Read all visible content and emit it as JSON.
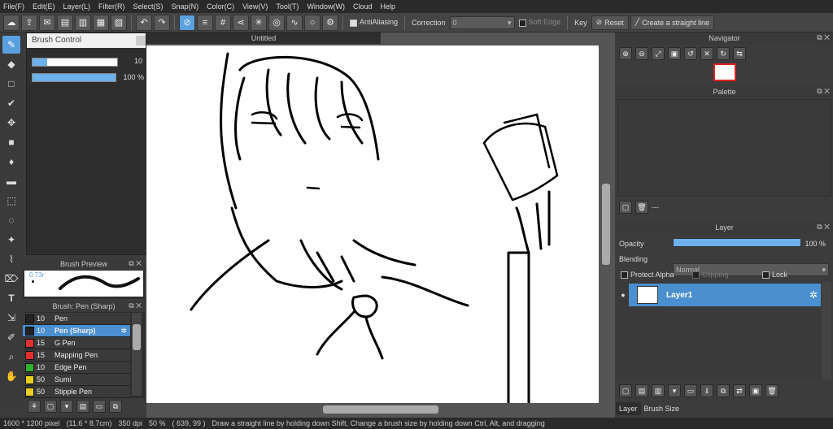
{
  "menu": [
    "File(F)",
    "Edit(E)",
    "Layer(L)",
    "Filter(R)",
    "Select(S)",
    "Snap(N)",
    "Color(C)",
    "View(V)",
    "Tool(T)",
    "Window(W)",
    "Cloud",
    "Help"
  ],
  "toolbar": {
    "antialiasing": "AntiAliasing",
    "correction": "Correction",
    "correction_value": "0",
    "soft_edge": "Soft Edge",
    "key": "Key",
    "reset": "Reset",
    "straight_line": "Create a straight line"
  },
  "brush_control": {
    "title": "Brush Control",
    "size_value": "10",
    "size_fraction": 0.17,
    "opacity_value": "100 %",
    "opacity_fraction": 1.0
  },
  "brush_preview": {
    "title": "Brush Preview",
    "size_label": "0.73r"
  },
  "brush_list": {
    "title": "Brush: Pen (Sharp)",
    "items": [
      {
        "size": "10",
        "name": "Pen",
        "color": "#222222",
        "selected": false
      },
      {
        "size": "10",
        "name": "Pen (Sharp)",
        "color": "#222222",
        "selected": true
      },
      {
        "size": "15",
        "name": "G Pen",
        "color": "#e03030",
        "selected": false
      },
      {
        "size": "15",
        "name": "Mapping Pen",
        "color": "#e03030",
        "selected": false
      },
      {
        "size": "10",
        "name": "Edge Pen",
        "color": "#30b030",
        "selected": false
      },
      {
        "size": "50",
        "name": "Sumi",
        "color": "#e8d020",
        "selected": false
      },
      {
        "size": "50",
        "name": "Stipple Pen",
        "color": "#e8d020",
        "selected": false
      }
    ]
  },
  "canvas": {
    "tab": "Untitled"
  },
  "navigator": {
    "title": "Navigator"
  },
  "palette": {
    "title": "Palette",
    "footer_text": "---"
  },
  "layer_panel": {
    "title": "Layer",
    "opacity_label": "Opacity",
    "opacity_value": "100 %",
    "opacity_fraction": 1.0,
    "blending_label": "Blending",
    "blending_value": "Normal",
    "protect_alpha": "Protect Alpha",
    "clipping": "Clipping",
    "lock": "Lock",
    "layer_name": "Layer1",
    "tabs": [
      "Layer",
      "Brush Size"
    ]
  },
  "status": {
    "size": "1600 * 1200 pixel",
    "cm": "(11.6 * 8.7cm)",
    "dpi": "350 dpi",
    "zoom": "50 %",
    "coords": "( 639, 99 )",
    "hint": "Draw a straight line by holding down Shift, Change a brush size by holding down Ctrl, Alt, and dragging"
  },
  "colors": {
    "accent": "#5aa0e0",
    "panel": "#3c3c3c",
    "menubar": "#2a2a2a"
  }
}
